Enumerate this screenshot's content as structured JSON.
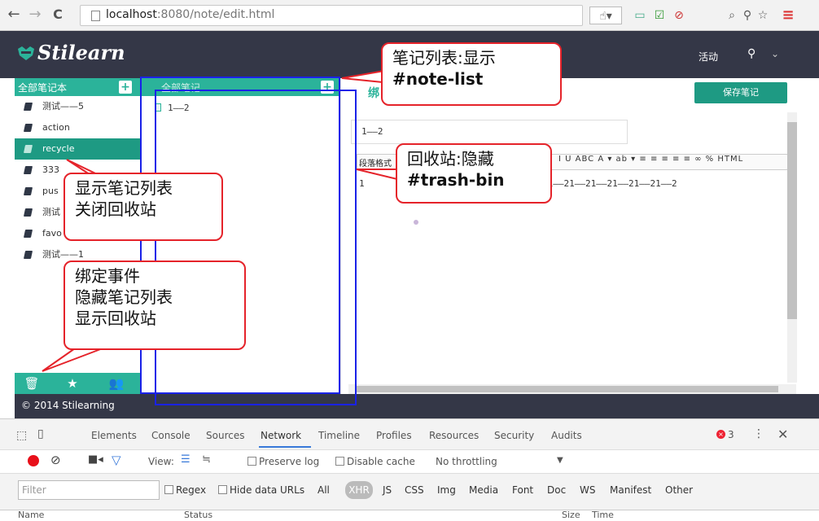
{
  "browser": {
    "url_host": "localhost",
    "url_path": ":8080/note/edit.html",
    "back": "←",
    "forward": "→",
    "reload": "C"
  },
  "app": {
    "logo": "Stilearn",
    "activity": "活动",
    "footer": "© 2014 Stilearning"
  },
  "left_panel": {
    "header": "全部笔记本",
    "notebooks": [
      "测试——5",
      "action",
      "recycle",
      "333",
      "pus",
      "测试",
      "favo",
      "测试——1"
    ],
    "selected": "recycle"
  },
  "middle_panel": {
    "header": "全部笔记",
    "notes": [
      "1——2"
    ]
  },
  "editor": {
    "save_button": "保存笔记",
    "title_icon": "绑",
    "title_value": "1——2",
    "format_label": "段落格式",
    "content_start": "1",
    "content_text": "21——21——21——21——21——21——2",
    "toolbar_icons": "I U ABC A ▾ ab ▾ ≡ ≡ ≡ ≡ ≡ ∞ % HTML"
  },
  "devtools": {
    "tabs": [
      "Elements",
      "Console",
      "Sources",
      "Network",
      "Timeline",
      "Profiles",
      "Resources",
      "Security",
      "Audits"
    ],
    "active_tab": "Network",
    "error_count": "3",
    "view_label": "View:",
    "preserve_log": "Preserve log",
    "disable_cache": "Disable cache",
    "throttling": "No throttling",
    "filter_placeholder": "Filter",
    "regex": "Regex",
    "hide_data_urls": "Hide data URLs",
    "types": [
      "All",
      "XHR",
      "JS",
      "CSS",
      "Img",
      "Media",
      "Font",
      "Doc",
      "WS",
      "Manifest",
      "Other"
    ],
    "columns": [
      "Name",
      "Status",
      "Size",
      "Time"
    ]
  },
  "annotations": {
    "note_list": [
      "笔记列表:显示",
      "#note-list"
    ],
    "trash_bin": [
      "回收站:隐藏",
      "#trash-bin"
    ],
    "show_list": [
      "显示笔记列表",
      "关闭回收站"
    ],
    "bind_event": [
      "绑定事件",
      "隐藏笔记列表",
      "显示回收站"
    ]
  },
  "colors": {
    "accent": "#2bb39a",
    "header_dark": "#343747",
    "callout_border": "#e5232a",
    "overlay_blue": "#1a22e8"
  }
}
